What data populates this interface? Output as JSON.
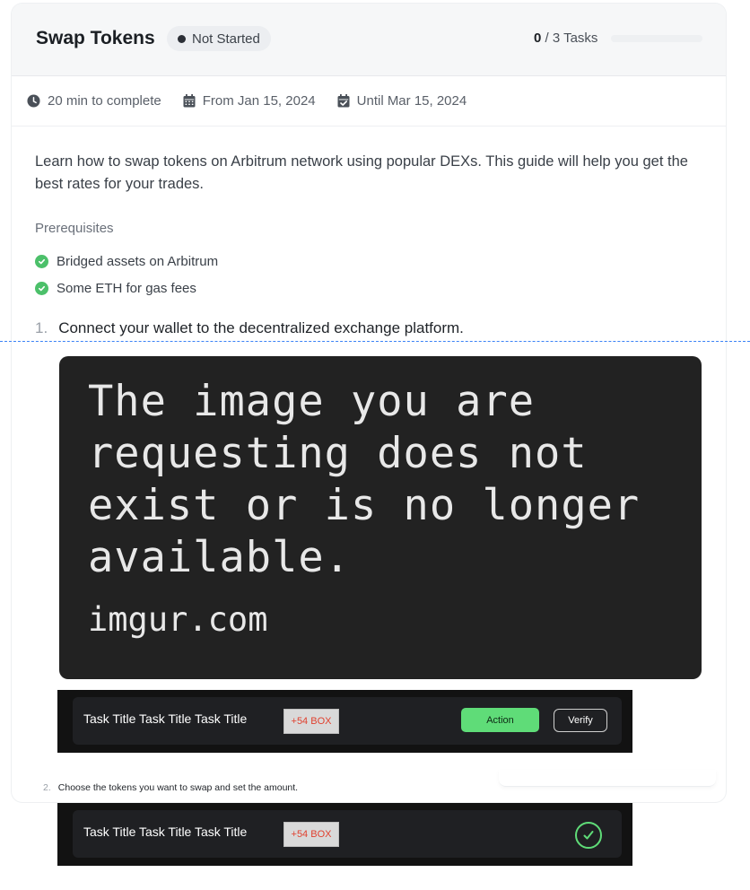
{
  "quest": {
    "title": "Swap Tokens",
    "status": "Not Started",
    "tasks_done": "0",
    "tasks_total_label": "/ 3 Tasks",
    "progress_fraction": 0
  },
  "meta": {
    "duration": "20 min to complete",
    "from": "From Jan 15, 2024",
    "until": "Until Mar 15, 2024"
  },
  "description": "Learn how to swap tokens on Arbitrum network using popular DEXs. This guide will help you get the best rates for your trades.",
  "prerequisites": {
    "title": "Prerequisites",
    "items": [
      "Bridged assets on Arbitrum",
      "Some ETH for gas fees"
    ]
  },
  "steps": [
    {
      "number": "1.",
      "text": "Connect your wallet to the decentralized exchange platform."
    },
    {
      "number": "2.",
      "text": "Choose the tokens you want to swap and set the amount."
    }
  ],
  "missing_image": {
    "message": "The image you are requesting does not exist or is no longer available.",
    "site": "imgur.com"
  },
  "task_rows": [
    {
      "title": "Task Title Task Title Task Title",
      "badge": "+54 BOX",
      "action_label": "Action",
      "verify_label": "Verify"
    },
    {
      "title": "Task Title Task Title Task Title",
      "badge": "+54 BOX",
      "completed": true
    }
  ],
  "colors": {
    "accent_green": "#5fdc78",
    "check_green": "#4cc06a",
    "dashed_blue": "#3b82f6",
    "badge_text_red": "#e0412f"
  },
  "icons": [
    "clock-icon",
    "calendar-icon",
    "calendar-check-icon",
    "check-circle-icon",
    "checkmark-circle-icon"
  ]
}
